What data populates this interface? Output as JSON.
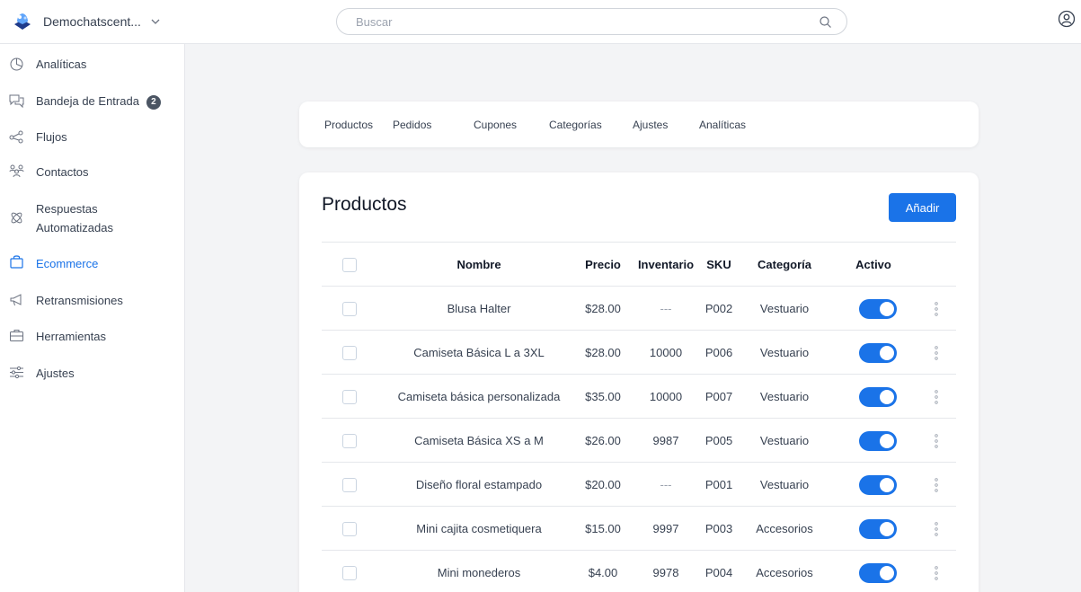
{
  "header": {
    "brand_name": "Demochatscent...",
    "search_placeholder": "Buscar"
  },
  "sidebar": {
    "items": [
      {
        "label": "Analíticas",
        "icon": "pie-chart-icon"
      },
      {
        "label": "Bandeja de Entrada",
        "icon": "chat-bubbles-icon",
        "badge": "2"
      },
      {
        "label": "Flujos",
        "icon": "flow-icon"
      },
      {
        "label": "Contactos",
        "icon": "contacts-icon"
      },
      {
        "label_line1": "Respuestas",
        "label_line2": "Automatizadas",
        "icon": "atom-icon"
      },
      {
        "label": "Ecommerce",
        "icon": "shopping-bag-icon",
        "active": true
      },
      {
        "label": "Retransmisiones",
        "icon": "megaphone-icon"
      },
      {
        "label": "Herramientas",
        "icon": "toolbox-icon"
      },
      {
        "label": "Ajustes",
        "icon": "sliders-icon"
      }
    ]
  },
  "tabs": [
    "Productos",
    "Pedidos",
    "Cupones",
    "Categorías",
    "Ajustes",
    "Analíticas"
  ],
  "products": {
    "title": "Productos",
    "add_label": "Añadir",
    "columns": {
      "name": "Nombre",
      "price": "Precio",
      "inventory": "Inventario",
      "sku": "SKU",
      "category": "Categoría",
      "active": "Activo"
    },
    "rows": [
      {
        "name": "Blusa Halter",
        "price": "$28.00",
        "inventory": "---",
        "sku": "P002",
        "category": "Vestuario",
        "active": true
      },
      {
        "name": "Camiseta Básica L a 3XL",
        "price": "$28.00",
        "inventory": "10000",
        "sku": "P006",
        "category": "Vestuario",
        "active": true
      },
      {
        "name": "Camiseta básica personalizada",
        "price": "$35.00",
        "inventory": "10000",
        "sku": "P007",
        "category": "Vestuario",
        "active": true
      },
      {
        "name": "Camiseta Básica XS a M",
        "price": "$26.00",
        "inventory": "9987",
        "sku": "P005",
        "category": "Vestuario",
        "active": true
      },
      {
        "name": "Diseño floral estampado",
        "price": "$20.00",
        "inventory": "---",
        "sku": "P001",
        "category": "Vestuario",
        "active": true
      },
      {
        "name": "Mini cajita cosmetiquera",
        "price": "$15.00",
        "inventory": "9997",
        "sku": "P003",
        "category": "Accesorios",
        "active": true
      },
      {
        "name": "Mini monederos",
        "price": "$4.00",
        "inventory": "9978",
        "sku": "P004",
        "category": "Accesorios",
        "active": true
      }
    ]
  },
  "colors": {
    "accent": "#1a73e8",
    "badge": "#4b5563",
    "border": "#e5e7eb",
    "background": "#f3f4f6"
  }
}
